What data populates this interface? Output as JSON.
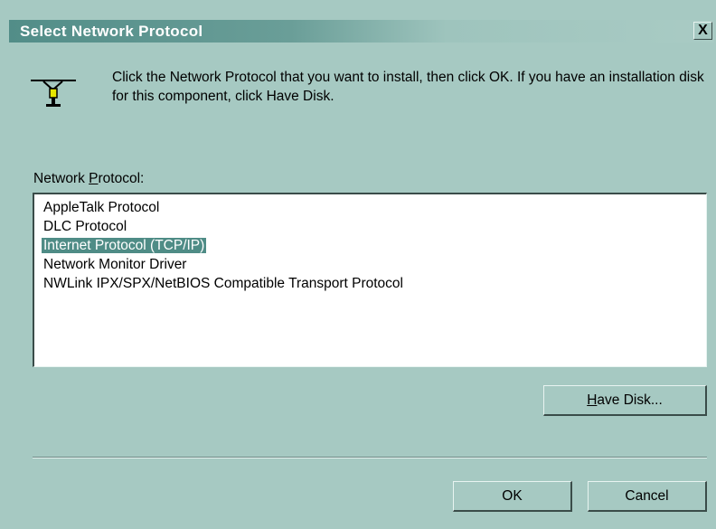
{
  "window": {
    "title": "Select Network Protocol",
    "close_label": "X"
  },
  "intro_text": "Click the Network Protocol that you want to install, then click OK. If you have an installation disk for this component, click Have Disk.",
  "list": {
    "label_prefix": "Network ",
    "label_accel": "P",
    "label_rest": "rotocol:",
    "items": [
      "AppleTalk Protocol",
      "DLC Protocol",
      "Internet Protocol (TCP/IP)",
      "Network Monitor Driver",
      "NWLink IPX/SPX/NetBIOS Compatible Transport Protocol"
    ],
    "selected": "Internet Protocol (TCP/IP)"
  },
  "buttons": {
    "have_disk_accel": "H",
    "have_disk_rest": "ave Disk...",
    "ok": "OK",
    "cancel": "Cancel"
  },
  "icons": {
    "protocol": "network-protocol-icon"
  },
  "colors": {
    "face": "#a6c9c2",
    "title_active": "#528d88",
    "selection": "#4f8c86"
  }
}
